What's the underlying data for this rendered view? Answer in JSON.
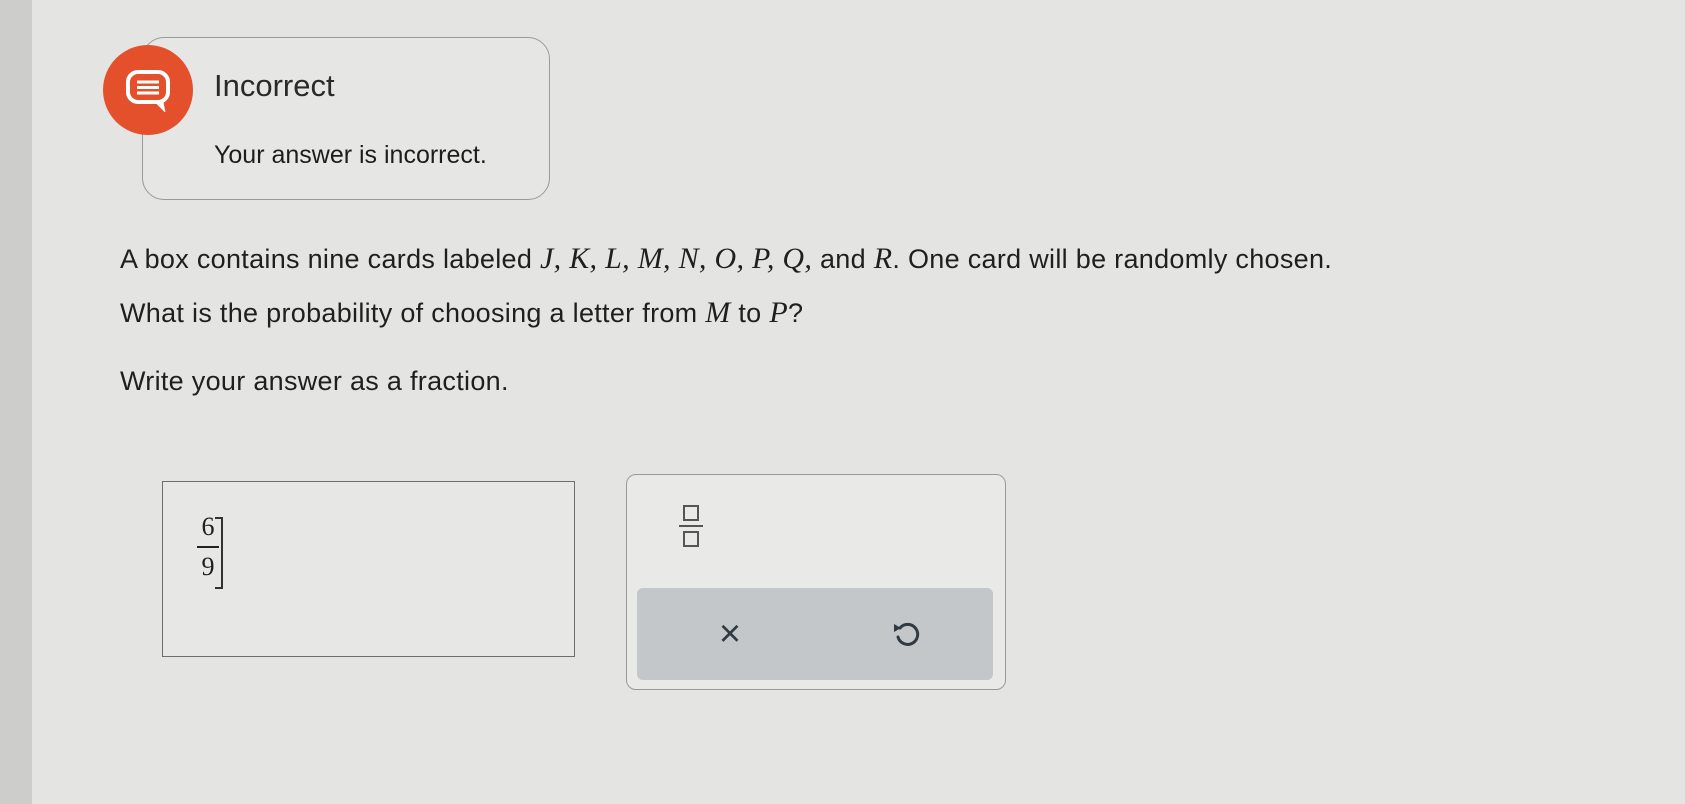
{
  "feedback": {
    "title": "Incorrect",
    "message": "Your answer is incorrect.",
    "badge_color": "#e4502b",
    "icon": "chat-bubble-icon"
  },
  "question": {
    "part1": "A box contains nine cards labeled ",
    "letters": "J, K, L, M, N, O, P, Q,",
    "part2": " and ",
    "letter_last": "R",
    "part3": ". One card will be randomly chosen.",
    "part4": "What is the probability of choosing a letter from ",
    "range_start": "M",
    "part5": " to ",
    "range_end": "P",
    "part6": "?"
  },
  "instruction": "Write your answer as a fraction.",
  "answer": {
    "numerator": "6",
    "denominator": "9"
  },
  "toolbox": {
    "fraction_icon": "fraction-template-icon",
    "clear_label": "×",
    "undo_icon": "undo-icon"
  }
}
